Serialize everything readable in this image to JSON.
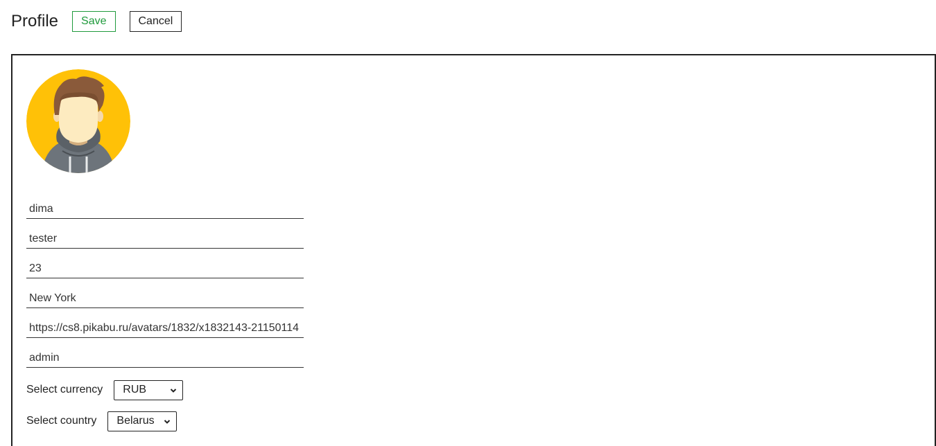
{
  "header": {
    "title": "Profile",
    "save_label": "Save",
    "cancel_label": "Cancel"
  },
  "profile": {
    "avatar": {
      "icon": "avatar-hoodie-icon",
      "background_color": "#FFC107"
    },
    "fields": {
      "first_name": "dima",
      "last_name": "tester",
      "age": "23",
      "city": "New York",
      "avatar_url": "https://cs8.pikabu.ru/avatars/1832/x1832143-21150114",
      "username": "admin"
    },
    "currency": {
      "label": "Select currency",
      "selected": "RUB"
    },
    "country": {
      "label": "Select country",
      "selected": "Belarus"
    }
  },
  "colors": {
    "save_accent": "#1F9A3C",
    "border": "#222222"
  }
}
